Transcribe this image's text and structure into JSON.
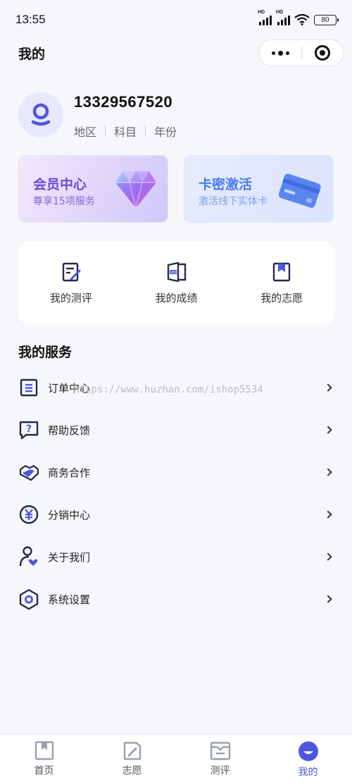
{
  "status_bar": {
    "time": "13:55",
    "battery": "80",
    "hd1": "HD",
    "hd2": "HD"
  },
  "nav": {
    "title": "我的"
  },
  "profile": {
    "phone": "13329567520",
    "tags": [
      "地区",
      "科目",
      "年份"
    ]
  },
  "cards": {
    "vip": {
      "title": "会员中心",
      "subtitle": "尊享15项服务"
    },
    "key": {
      "title": "卡密激活",
      "subtitle": "激活线下实体卡"
    }
  },
  "quick": [
    {
      "label": "我的测评",
      "icon": "edit-doc-icon"
    },
    {
      "label": "我的成绩",
      "icon": "score-book-icon"
    },
    {
      "label": "我的志愿",
      "icon": "bookmark-icon"
    }
  ],
  "services": {
    "title": "我的服务",
    "items": [
      {
        "label": "订单中心",
        "icon": "order-list-icon"
      },
      {
        "label": "帮助反馈",
        "icon": "help-chat-icon"
      },
      {
        "label": "商务合作",
        "icon": "handshake-icon"
      },
      {
        "label": "分销中心",
        "icon": "yen-coin-icon"
      },
      {
        "label": "关于我们",
        "icon": "user-heart-icon"
      },
      {
        "label": "系统设置",
        "icon": "hex-settings-icon"
      }
    ]
  },
  "watermark": "https://www.huzhan.com/ishop5534",
  "tabbar": [
    {
      "label": "首页",
      "icon": "home-book-icon"
    },
    {
      "label": "志愿",
      "icon": "volunteer-doc-icon"
    },
    {
      "label": "测评",
      "icon": "eval-card-icon"
    },
    {
      "label": "我的",
      "icon": "profile-icon",
      "active": true
    }
  ],
  "colors": {
    "accent": "#4e55e0",
    "vip": "#6a4bd6",
    "key": "#4a7bf0",
    "icon_dark": "#232a4a"
  }
}
